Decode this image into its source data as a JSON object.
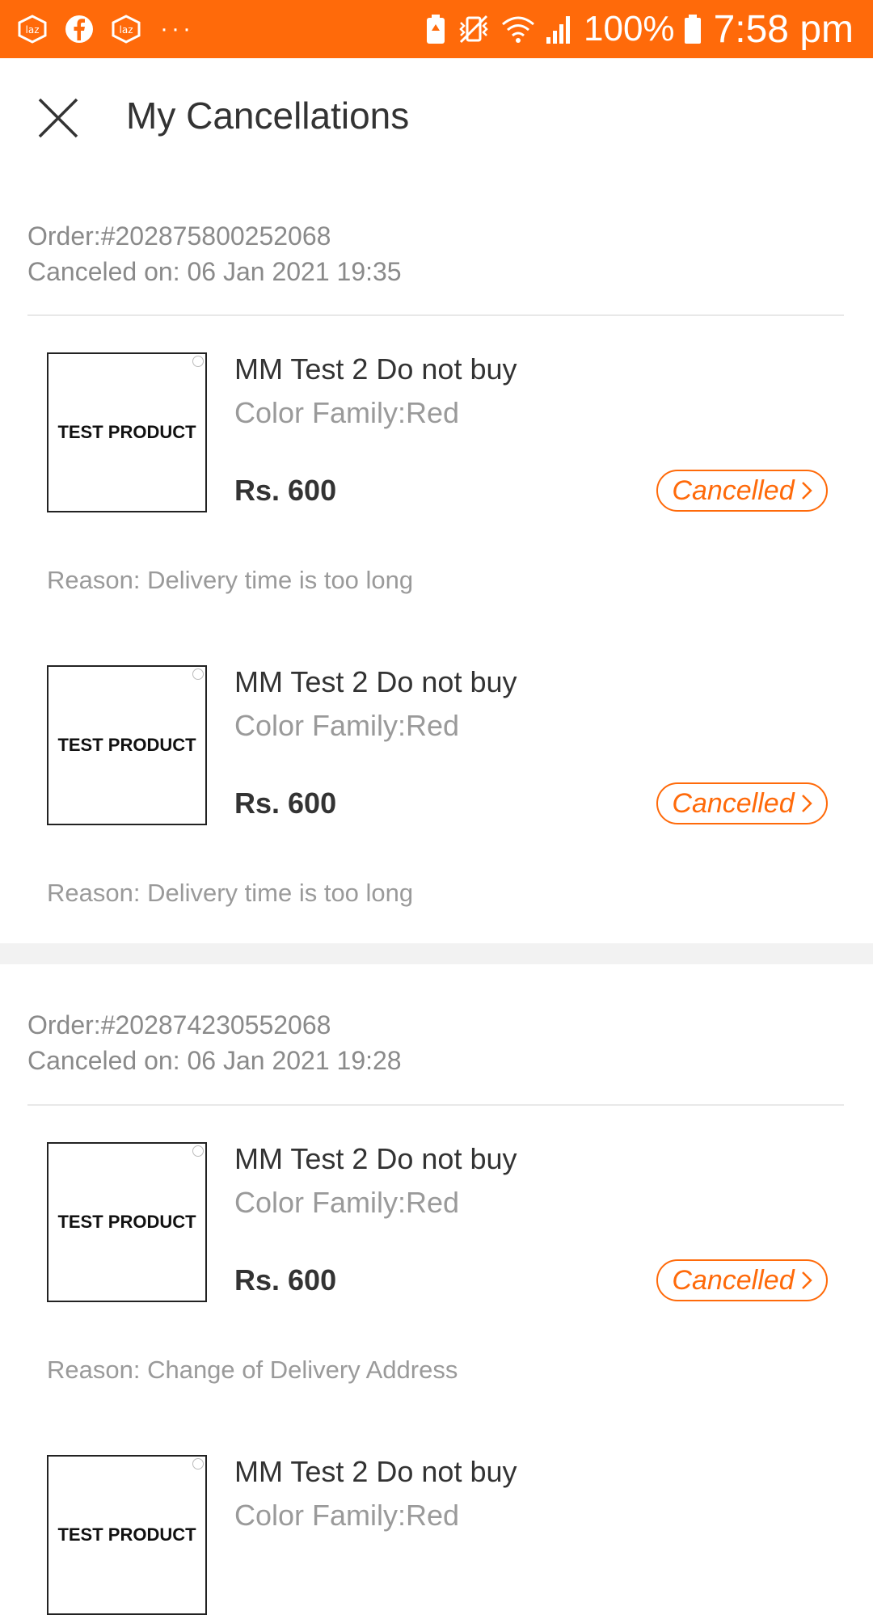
{
  "status_bar": {
    "left_icons": [
      "laz-icon",
      "facebook-icon",
      "laz-icon"
    ],
    "more": "···",
    "battery_percent": "100%",
    "time": "7:58 pm"
  },
  "header": {
    "title": "My Cancellations"
  },
  "orders": [
    {
      "order_label": "Order:#202875800252068",
      "canceled_on": "Canceled on: 06 Jan 2021 19:35",
      "items": [
        {
          "thumb_text": "TEST PRODUCT",
          "name": "MM Test 2 Do not buy",
          "variant": "Color Family:Red",
          "price": "Rs. 600",
          "status": "Cancelled",
          "reason": "Reason: Delivery time is too long"
        },
        {
          "thumb_text": "TEST PRODUCT",
          "name": "MM Test 2 Do not buy",
          "variant": "Color Family:Red",
          "price": "Rs. 600",
          "status": "Cancelled",
          "reason": "Reason: Delivery time is too long"
        }
      ]
    },
    {
      "order_label": "Order:#202874230552068",
      "canceled_on": "Canceled on: 06 Jan 2021 19:28",
      "items": [
        {
          "thumb_text": "TEST PRODUCT",
          "name": "MM Test 2 Do not buy",
          "variant": "Color Family:Red",
          "price": "Rs. 600",
          "status": "Cancelled",
          "reason": "Reason: Change of Delivery Address"
        },
        {
          "thumb_text": "TEST PRODUCT",
          "name": "MM Test 2 Do not buy",
          "variant": "Color Family:Red"
        }
      ]
    }
  ],
  "colors": {
    "accent": "#ff6a0a",
    "text_primary": "#333333",
    "text_secondary": "#9a9a9a",
    "separator": "#f2f2f2"
  }
}
